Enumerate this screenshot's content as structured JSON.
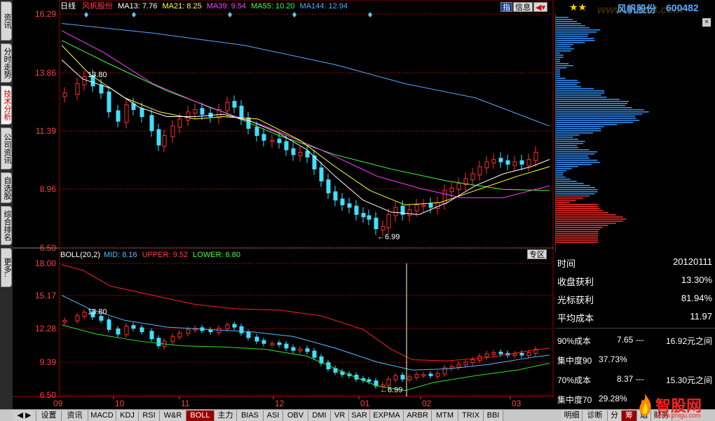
{
  "header": {
    "period": "日线",
    "stock_name": "风帆股份",
    "ma13": "MA13: 7.76",
    "ma21": "MA21: 8.25",
    "ma39": "MA39: 9.54",
    "ma55": "MA55: 10.20",
    "ma144": "MA144: 12.94",
    "btn_zhi": "指",
    "btn_info": "信息",
    "right_title": "风帆股份",
    "right_code": "600482",
    "right_watermark": "www.55188.com"
  },
  "colors": {
    "ma13": "#ffffff",
    "ma21": "#ffff40",
    "ma39": "#ff40ff",
    "ma55": "#40ff40",
    "ma144": "#55aaff",
    "up": "#ff3030",
    "down": "#40e0ff",
    "upper": "#ff2020",
    "mid": "#55bbff",
    "lower": "#30e030",
    "grid": "#a00000"
  },
  "left_tabs": [
    {
      "label": "资讯",
      "active": false
    },
    {
      "label": "分时走势",
      "active": false
    },
    {
      "label": "技术分析",
      "active": true
    },
    {
      "label": "公司资讯",
      "active": false
    },
    {
      "label": "自选股",
      "active": false
    },
    {
      "label": "综合排名",
      "active": false
    },
    {
      "label": "更多..",
      "active": false
    }
  ],
  "price_axis": [
    "16.29",
    "13.86",
    "11.39",
    "8.96",
    "6.50"
  ],
  "price_annotations": {
    "high": "13.80",
    "low": "6.99"
  },
  "boll": {
    "title": "BOLL(20,2)",
    "mid": "MID: 8.16",
    "upper": "UPPER: 9.52",
    "lower": "LOWER: 6.80",
    "zone_btn": "专区",
    "axis": [
      "18.00",
      "15.17",
      "12.28",
      "9.39",
      "6.50"
    ],
    "high": "13.80",
    "low": "6.99"
  },
  "x_axis": [
    "09",
    "10",
    "11",
    "12",
    "01",
    "02",
    "03"
  ],
  "right_info": [
    {
      "k": "时间",
      "v": "20120111"
    },
    {
      "k": "收盘获利",
      "v": "13.30%"
    },
    {
      "k": "光标获利",
      "v": "81.94%"
    },
    {
      "k": "平均成本",
      "v": "11.97"
    }
  ],
  "right_cost": [
    {
      "k": "90%成本",
      "a": "7.65 ---",
      "b": "16.92元之间"
    },
    {
      "k": "集中度90",
      "a": "37.73%",
      "b": ""
    },
    {
      "k": "70%成本",
      "a": "8.37 ---",
      "b": "15.30元之间"
    },
    {
      "k": "集中度70",
      "a": "29.28%",
      "b": ""
    }
  ],
  "bottom_tabs": [
    {
      "label": "设置",
      "active": false
    },
    {
      "label": "资讯",
      "active": false
    },
    {
      "label": "MACD",
      "active": false
    },
    {
      "label": "KDJ",
      "active": false
    },
    {
      "label": "RSI",
      "active": false
    },
    {
      "label": "W&R",
      "active": false
    },
    {
      "label": "BOLL",
      "active": true
    },
    {
      "label": "主力",
      "active": false
    },
    {
      "label": "BIAS",
      "active": false
    },
    {
      "label": "ASI",
      "active": false
    },
    {
      "label": "OBV",
      "active": false
    },
    {
      "label": "DMI",
      "active": false
    },
    {
      "label": "VR",
      "active": false
    },
    {
      "label": "SAR",
      "active": false
    },
    {
      "label": "EXPMA",
      "active": false
    },
    {
      "label": "ARBR",
      "active": false
    },
    {
      "label": "MTM",
      "active": false
    },
    {
      "label": "TRIX",
      "active": false
    },
    {
      "label": "BBI",
      "active": false
    },
    {
      "label": "明细",
      "active": false
    },
    {
      "label": "诊断",
      "active": false
    },
    {
      "label": "分",
      "active": false
    },
    {
      "label": "筹",
      "active": true
    },
    {
      "label": "焰",
      "active": false
    },
    {
      "label": "财务",
      "active": false
    }
  ],
  "logo_text": "智股网",
  "logo_url": "www.zhigu.com"
}
